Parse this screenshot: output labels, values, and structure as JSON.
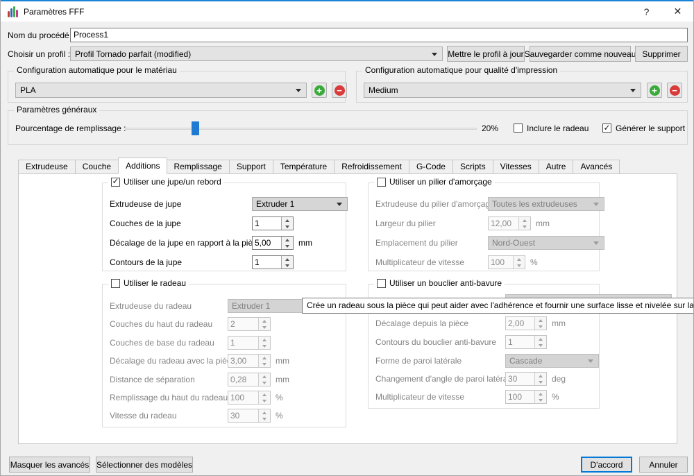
{
  "window": {
    "title": "Paramètres FFF",
    "help": "?",
    "close": "✕"
  },
  "colors": {
    "accent": "#0078d7",
    "slider_thumb": "#1f7ad3",
    "plus_green": "#3aaa3a",
    "minus_red": "#d93a3a"
  },
  "header": {
    "process_name_label": "Nom du procédé :",
    "process_name_value": "Process1",
    "profile_label": "Choisir un profil :",
    "profile_value": "Profil Tornado parfait (modified)",
    "update_profile": "Mettre le profil à jour",
    "save_as_new": "Sauvegarder comme nouveau",
    "delete": "Supprimer"
  },
  "material_group": {
    "title": "Configuration automatique pour le matériau",
    "value": "PLA",
    "plus": "+",
    "minus": "−"
  },
  "quality_group": {
    "title": "Configuration automatique pour qualité d'impression",
    "value": "Medium",
    "plus": "+",
    "minus": "−"
  },
  "general_group": {
    "title": "Paramètres généraux",
    "infill_label": "Pourcentage de remplissage :",
    "infill_value": "20%",
    "include_raft_label": "Inclure le radeau",
    "include_raft_checked": false,
    "generate_support_label": "Générer le support",
    "generate_support_checked": true
  },
  "tabs": [
    "Extrudeuse",
    "Couche",
    "Additions",
    "Remplissage",
    "Support",
    "Température",
    "Refroidissement",
    "G-Code",
    "Scripts",
    "Vitesses",
    "Autre",
    "Avancés"
  ],
  "active_tab": "Additions",
  "groups": {
    "skirt": {
      "title": "Utiliser une jupe/un rebord",
      "checked": true,
      "rows": [
        {
          "label": "Extrudeuse de jupe",
          "value": "Extruder 1",
          "type": "select"
        },
        {
          "label": "Couches de la jupe",
          "value": "1",
          "unit": ""
        },
        {
          "label": "Décalage de la jupe en rapport à la pièce",
          "value": "5,00",
          "unit": "mm"
        },
        {
          "label": "Contours de la jupe",
          "value": "1",
          "unit": ""
        }
      ]
    },
    "pillar": {
      "title": "Utiliser un pilier d'amorçage",
      "checked": false,
      "rows": [
        {
          "label": "Extrudeuse du pilier d'amorçage",
          "value": "Toutes les extrudeuses",
          "type": "select"
        },
        {
          "label": "Largeur du pilier",
          "value": "12,00",
          "unit": "mm"
        },
        {
          "label": "Emplacement du pilier",
          "value": "Nord-Ouest",
          "type": "select"
        },
        {
          "label": "Multiplicateur de vitesse",
          "value": "100",
          "unit": "%"
        }
      ]
    },
    "raft": {
      "title": "Utiliser le radeau",
      "checked": false,
      "rows": [
        {
          "label": "Extrudeuse du radeau",
          "value": "Extruder 1",
          "type": "select"
        },
        {
          "label": "Couches du haut du radeau",
          "value": "2",
          "unit": ""
        },
        {
          "label": "Couches de base du radeau",
          "value": "1",
          "unit": ""
        },
        {
          "label": "Décalage du radeau avec la pièce",
          "value": "3,00",
          "unit": "mm"
        },
        {
          "label": "Distance de séparation",
          "value": "0,28",
          "unit": "mm"
        },
        {
          "label": "Remplissage du haut du radeau",
          "value": "100",
          "unit": "%"
        },
        {
          "label": "Vitesse du radeau",
          "value": "30",
          "unit": "%"
        }
      ]
    },
    "shield": {
      "title": "Utiliser un bouclier anti-bavure",
      "checked": false,
      "rows": [
        {
          "label": "",
          "value": "",
          "type": "select"
        },
        {
          "label": "Décalage depuis la pièce",
          "value": "2,00",
          "unit": "mm"
        },
        {
          "label": "Contours du bouclier anti-bavure",
          "value": "1",
          "unit": ""
        },
        {
          "label": "Forme de paroi latérale",
          "value": "Cascade",
          "type": "select"
        },
        {
          "label": "Changement d'angle de paroi latérale",
          "value": "30",
          "unit": "deg"
        },
        {
          "label": "Multiplicateur de vitesse",
          "value": "100",
          "unit": "%"
        }
      ]
    }
  },
  "tooltip": "Crée un radeau sous la pièce qui peut aider avec l'adhérence et fournir une surface lisse et nivelée sur laque",
  "footer": {
    "hide_advanced": "Masquer les avancés",
    "select_models": "Sélectionner des modèles",
    "ok": "D'accord",
    "cancel": "Annuler"
  }
}
